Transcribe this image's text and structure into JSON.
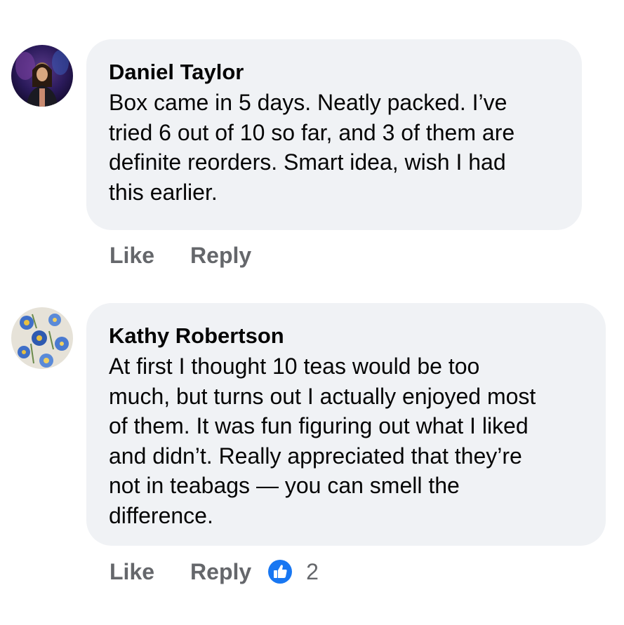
{
  "comments": [
    {
      "author": "Daniel Taylor",
      "text": "Box came in 5 days. Neatly packed. I’ve\ntried 6 out of 10 so far, and 3 of them are\ndefinite reorders. Smart idea, wish I had\nthis earlier.",
      "actions": {
        "like": "Like",
        "reply": "Reply"
      },
      "avatar_icon": "profile-photo-dark-purple",
      "reaction_count": ""
    },
    {
      "author": "Kathy Robertson",
      "text": "At first I thought 10 teas would be too\nmuch, but turns out I actually enjoyed most\nof them. It was fun figuring out what I liked\nand didn’t. Really appreciated that they’re\nnot in teabags — you can smell the\ndifference.",
      "actions": {
        "like": "Like",
        "reply": "Reply"
      },
      "avatar_icon": "profile-photo-blue-floral",
      "reaction_icon": "thumbs-up-icon",
      "reaction_count": "2"
    }
  ],
  "colors": {
    "bubble_bg": "#f0f2f5",
    "text": "#050505",
    "secondary_text": "#65676b",
    "like_blue": "#1877f2"
  }
}
